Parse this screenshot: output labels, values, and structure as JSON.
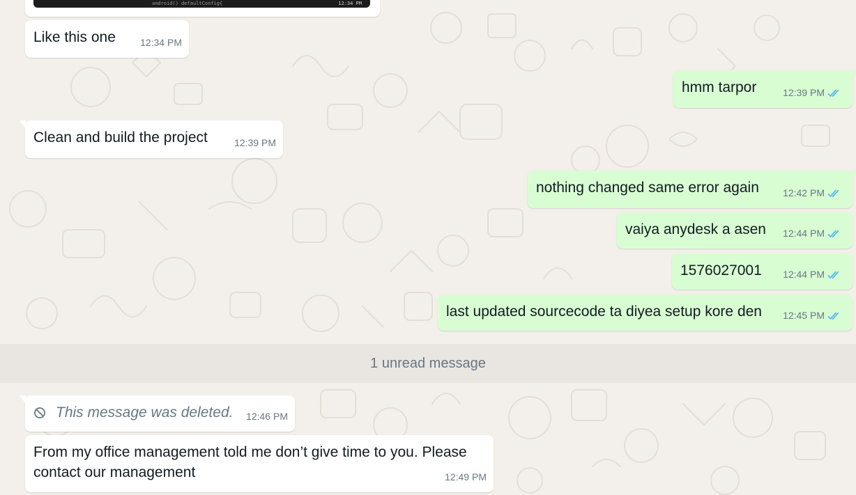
{
  "colors": {
    "incoming_bubble": "#ffffff",
    "outgoing_bubble": "#d9fdd3",
    "timestamp": "#667781",
    "read_tick": "#53bdeb",
    "wallpaper": "#f3efea"
  },
  "image_message": {
    "caption_fragment": "android()   defaultConfig{",
    "timestamp_fragment": "12:34 PM"
  },
  "messages": [
    {
      "direction": "in",
      "text": "Like this one",
      "time": "12:34 PM"
    },
    {
      "direction": "out",
      "text": "hmm tarpor",
      "time": "12:39 PM",
      "status": "read-double-tick-icon"
    },
    {
      "direction": "in",
      "text": "Clean and build the project",
      "time": "12:39 PM"
    },
    {
      "direction": "out",
      "text": "nothing changed same error again",
      "time": "12:42 PM",
      "status": "read-double-tick-icon"
    },
    {
      "direction": "out",
      "text": "vaiya anydesk a asen",
      "time": "12:44 PM",
      "status": "read-double-tick-icon"
    },
    {
      "direction": "out",
      "text": "1576027001",
      "time": "12:44 PM",
      "status": "read-double-tick-icon"
    },
    {
      "direction": "out",
      "text": "last updated sourcecode ta diyea setup kore den",
      "time": "12:45 PM",
      "status": "read-double-tick-icon"
    }
  ],
  "unread_divider": "1 unread message",
  "unread_messages": [
    {
      "direction": "in",
      "deleted": true,
      "text": "This message was deleted.",
      "time": "12:46 PM",
      "icon": "deleted-icon"
    },
    {
      "direction": "in",
      "text_line1": "From my office management  told me don’t give time to you. Please",
      "text_line2": "contact our management",
      "time": "12:49 PM"
    }
  ]
}
